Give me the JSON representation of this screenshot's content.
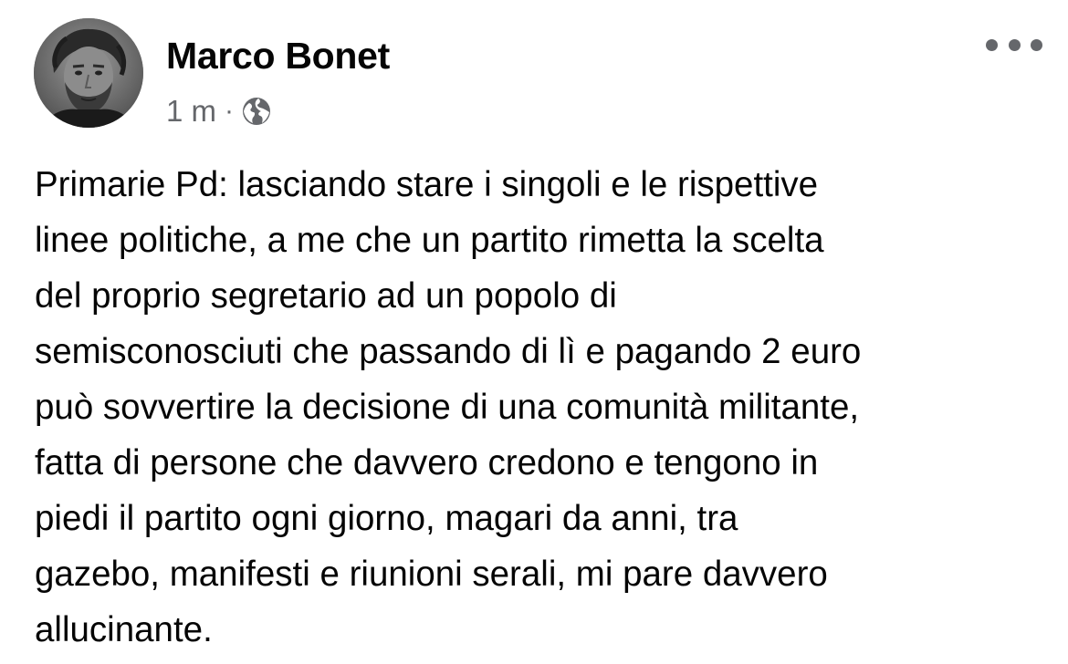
{
  "post": {
    "author_name": "Marco Bonet",
    "timestamp": "1 m",
    "separator": "·",
    "privacy_icon": "globe-icon",
    "more_icon": "more-horizontal-icon",
    "text_lines": [
      "Primarie Pd: lasciando stare i singoli e le rispettive",
      "linee politiche, a me che un partito rimetta la scelta",
      "del proprio segretario ad un popolo di",
      "semisconosciuti che passando di lì e pagando 2 euro",
      "può sovvertire la decisione di una comunità militante,",
      "fatta di persone che davvero credono e tengono in",
      "piedi il partito ogni giorno, magari da anni, tra",
      "gazebo, manifesti e riunioni serali, mi pare davvero",
      "allucinante."
    ]
  }
}
